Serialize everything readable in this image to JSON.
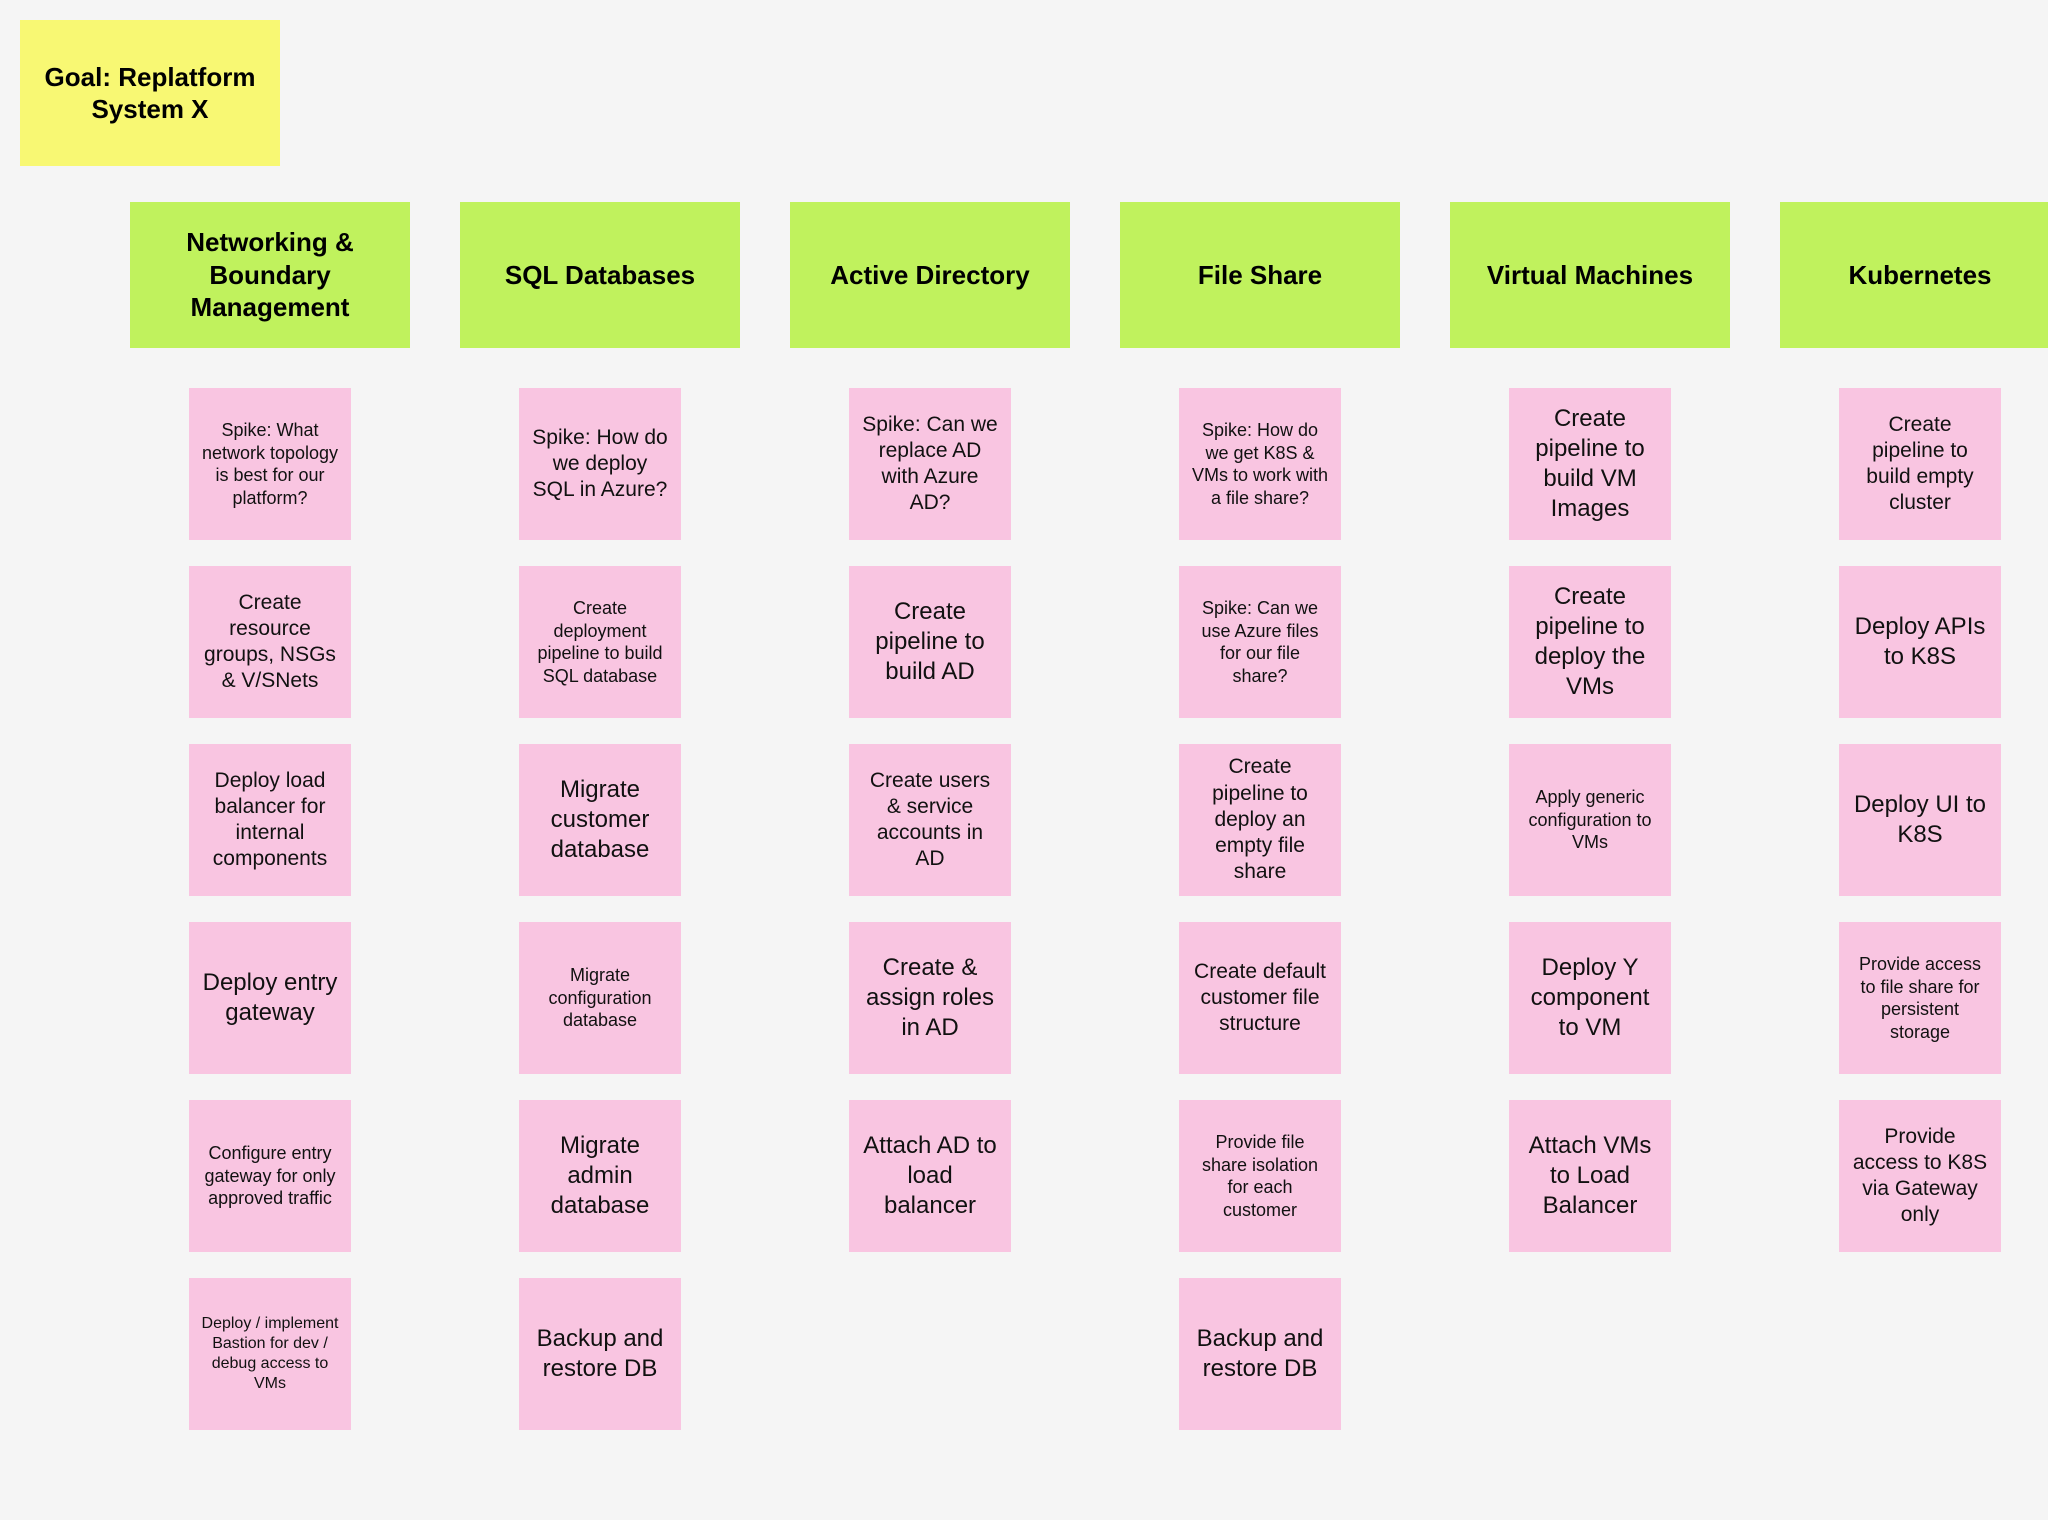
{
  "goal": "Goal: Replatform System X",
  "columns": [
    {
      "title": "Networking & Boundary Management",
      "cards": [
        {
          "text": "Spike: What network topology is best for our platform?",
          "size": "small"
        },
        {
          "text": "Create resource groups, NSGs & V/SNets",
          "size": ""
        },
        {
          "text": "Deploy load balancer for internal components",
          "size": ""
        },
        {
          "text": "Deploy entry gateway",
          "size": "large"
        },
        {
          "text": "Configure entry gateway for only approved traffic",
          "size": "small"
        },
        {
          "text": "Deploy / implement Bastion for dev / debug access to VMs",
          "size": "xsmall"
        }
      ]
    },
    {
      "title": "SQL Databases",
      "cards": [
        {
          "text": "Spike: How do we deploy SQL in Azure?",
          "size": ""
        },
        {
          "text": "Create deployment pipeline to build SQL database",
          "size": "small"
        },
        {
          "text": "Migrate customer database",
          "size": "large"
        },
        {
          "text": "Migrate configuration database",
          "size": "small"
        },
        {
          "text": "Migrate admin database",
          "size": "large"
        },
        {
          "text": "Backup and restore DB",
          "size": "large"
        }
      ]
    },
    {
      "title": "Active Directory",
      "cards": [
        {
          "text": "Spike: Can we replace AD with Azure AD?",
          "size": ""
        },
        {
          "text": "Create pipeline to build AD",
          "size": "large"
        },
        {
          "text": "Create users & service accounts in AD",
          "size": ""
        },
        {
          "text": "Create & assign roles in AD",
          "size": "large"
        },
        {
          "text": "Attach AD to load balancer",
          "size": "large"
        }
      ]
    },
    {
      "title": "File Share",
      "cards": [
        {
          "text": "Spike: How do we get K8S & VMs to work with a file share?",
          "size": "small"
        },
        {
          "text": "Spike: Can we use Azure files for our file share?",
          "size": "small"
        },
        {
          "text": "Create pipeline to deploy an empty file share",
          "size": ""
        },
        {
          "text": "Create default customer file structure",
          "size": ""
        },
        {
          "text": "Provide file share isolation for each customer",
          "size": "small"
        },
        {
          "text": "Backup and restore DB",
          "size": "large"
        }
      ]
    },
    {
      "title": "Virtual Machines",
      "cards": [
        {
          "text": "Create pipeline to build VM Images",
          "size": "large"
        },
        {
          "text": "Create pipeline to deploy the VMs",
          "size": "large"
        },
        {
          "text": "Apply generic configuration to VMs",
          "size": "small"
        },
        {
          "text": "Deploy Y component to VM",
          "size": "large"
        },
        {
          "text": "Attach VMs to Load Balancer",
          "size": "large"
        }
      ]
    },
    {
      "title": "Kubernetes",
      "cards": [
        {
          "text": "Create pipeline to build empty cluster",
          "size": ""
        },
        {
          "text": "Deploy APIs to K8S",
          "size": "large"
        },
        {
          "text": "Deploy UI to K8S",
          "size": "large"
        },
        {
          "text": "Provide access to file share for persistent storage",
          "size": "small"
        },
        {
          "text": "Provide access to K8S via Gateway only",
          "size": ""
        }
      ]
    }
  ]
}
